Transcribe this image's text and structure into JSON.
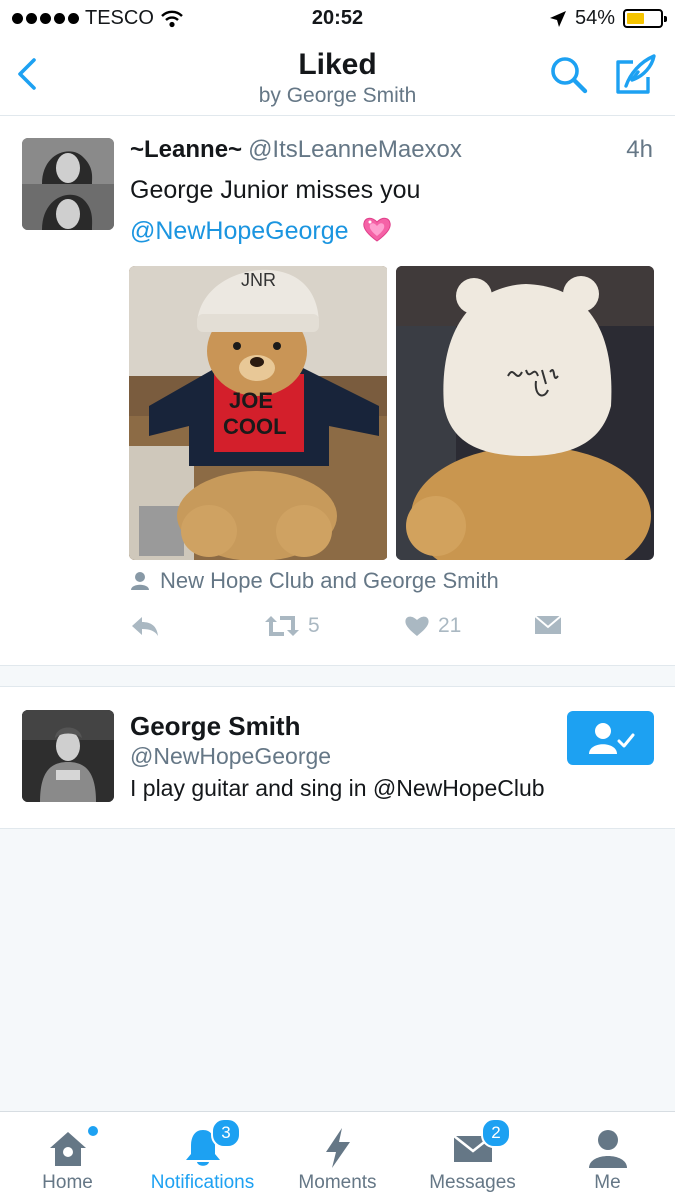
{
  "status_bar": {
    "carrier": "TESCO",
    "time": "20:52",
    "battery": "54%",
    "battery_level": 0.54
  },
  "header": {
    "title": "Liked",
    "subtitle": "by George Smith"
  },
  "tweet": {
    "name": "~Leanne~",
    "handle": "@ItsLeanneMaexox",
    "time": "4h",
    "text": "George Junior misses you",
    "mention": "@NewHopeGeorge",
    "emoji": "sparkling-heart",
    "tagged": "New Hope Club and George Smith",
    "retweets": "5",
    "likes": "21",
    "photo_texts": [
      "JNR",
      "JOE",
      "COOL"
    ]
  },
  "user_card": {
    "name": "George Smith",
    "handle": "@NewHopeGeorge",
    "bio": "I play guitar and sing in @NewHopeClub"
  },
  "tabs": [
    {
      "label": "Home",
      "icon": "home-icon"
    },
    {
      "label": "Notifications",
      "icon": "bell-icon",
      "badge": "3"
    },
    {
      "label": "Moments",
      "icon": "lightning-icon"
    },
    {
      "label": "Messages",
      "icon": "envelope-icon",
      "badge": "2"
    },
    {
      "label": "Me",
      "icon": "person-icon"
    }
  ],
  "colors": {
    "accent": "#1da1f2",
    "link": "#1b95e0",
    "muted": "#657786",
    "action": "#aab8c2"
  }
}
